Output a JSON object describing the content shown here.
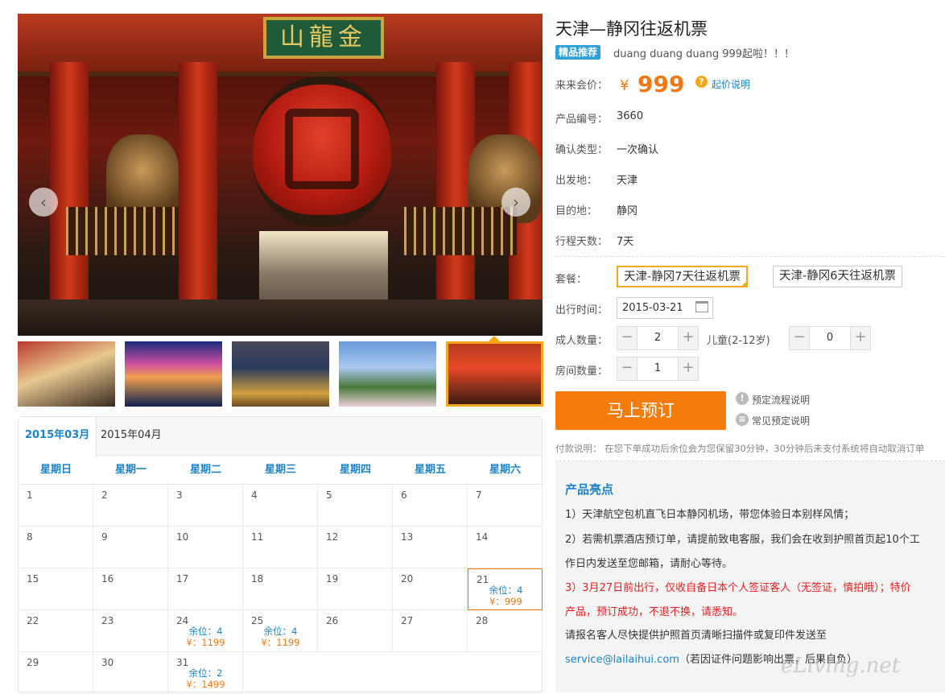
{
  "gallery": {
    "plaque_text": "山龍金",
    "prev_icon": "‹",
    "next_icon": "›",
    "thumbs": [
      "night-street",
      "city-canal",
      "street-food",
      "castle",
      "temple-gate"
    ]
  },
  "product": {
    "title": "天津—静冈往返机票",
    "badge": "精品推荐",
    "subtitle": "duang duang duang 999起啦！！！",
    "price_label": "来来会价：",
    "currency": "¥",
    "price": "999",
    "price_help": "起价说明",
    "info": [
      {
        "label": "产品编号：",
        "value": "3660"
      },
      {
        "label": "确认类型：",
        "value": "一次确认"
      },
      {
        "label": "出发地：",
        "value": "天津"
      },
      {
        "label": "目的地：",
        "value": "静冈"
      },
      {
        "label": "行程天数：",
        "value": "7天"
      }
    ]
  },
  "booking": {
    "package_label": "套餐：",
    "packages": [
      "天津-静冈7天往返机票",
      "天津-静冈6天往返机票"
    ],
    "date_label": "出行时间：",
    "date_value": "2015-03-21",
    "adult_label": "成人数量：",
    "adult_value": "2",
    "child_label": "儿童(2-12岁)",
    "child_value": "0",
    "room_label": "房间数量：",
    "room_value": "1",
    "minus": "−",
    "plus": "+",
    "book_button": "马上预订",
    "process_link": "预定流程说明",
    "faq_link": "常见预定说明",
    "payment_note": "付款说明：  在您下单成功后余位会为您保留30分钟，30分钟后未支付系统将自动取消订单"
  },
  "highlights": {
    "title": "产品亮点",
    "line1": "1）天津航空包机直飞日本静冈机场，带您体验日本别样风情；",
    "line2": "2）若需机票酒店预订单，请提前致电客服，我们会在收到护照首页起10个工",
    "line3": "作日内发送至您邮箱，请耐心等待。",
    "line4": "3）3月27日前出行，仅收自备日本个人签证客人（无签证，慎拍哦）；特价",
    "line5": "产品，预订成功，不退不换，请悉知。",
    "line6": "请报名客人尽快提供护照首页清晰扫描件或复印件发送至",
    "email": "service@lailaihui.com",
    "line7": "（若因证件问题影响出票，后果自负）"
  },
  "calendar": {
    "tabs": [
      "2015年03月",
      "2015年04月"
    ],
    "weekdays": [
      "星期日",
      "星期一",
      "星期二",
      "星期三",
      "星期四",
      "星期五",
      "星期六"
    ],
    "seat_prefix": "余位：",
    "price_prefix": "¥：",
    "days": [
      {
        "d": "1"
      },
      {
        "d": "2"
      },
      {
        "d": "3"
      },
      {
        "d": "4"
      },
      {
        "d": "5"
      },
      {
        "d": "6"
      },
      {
        "d": "7"
      },
      {
        "d": "8"
      },
      {
        "d": "9"
      },
      {
        "d": "10"
      },
      {
        "d": "11"
      },
      {
        "d": "12"
      },
      {
        "d": "13"
      },
      {
        "d": "14"
      },
      {
        "d": "15"
      },
      {
        "d": "16"
      },
      {
        "d": "17"
      },
      {
        "d": "18"
      },
      {
        "d": "19"
      },
      {
        "d": "20"
      },
      {
        "d": "21",
        "seat": "余位：4",
        "price": "¥：999",
        "selected": true
      },
      {
        "d": "22"
      },
      {
        "d": "23"
      },
      {
        "d": "24",
        "seat": "余位：4",
        "price": "¥：1199"
      },
      {
        "d": "25",
        "seat": "余位：4",
        "price": "¥：1199"
      },
      {
        "d": "26"
      },
      {
        "d": "27"
      },
      {
        "d": "28"
      },
      {
        "d": "29"
      },
      {
        "d": "30"
      },
      {
        "d": "31",
        "seat": "余位：2",
        "price": "¥：1499"
      }
    ]
  },
  "watermark": "eLiving.net",
  "colors": {
    "accent": "#1d83c4",
    "orange": "#f07814",
    "button": "#f57c0a",
    "highlight_border": "#f3a81c"
  }
}
